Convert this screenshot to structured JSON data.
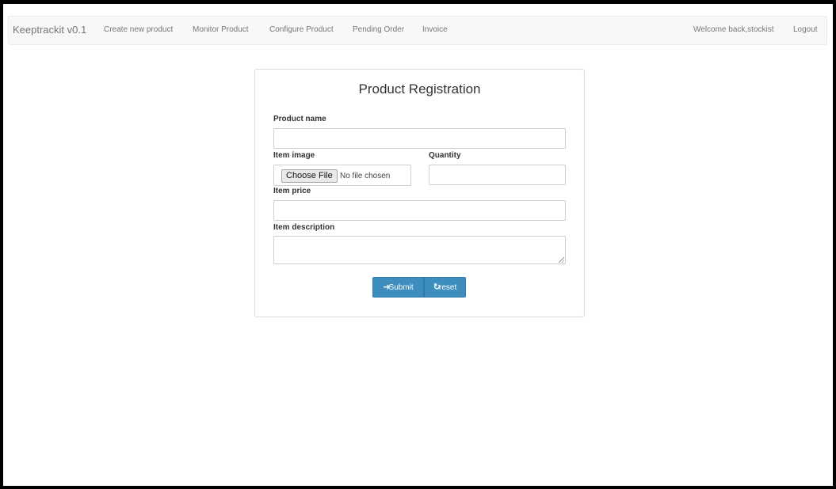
{
  "navbar": {
    "brand": "Keeptrackit v0.1",
    "links": [
      "Create new product",
      "Monitor Product",
      "Configure Product",
      "Pending Order",
      "Invoice"
    ],
    "welcome": "Welcome back,stockist",
    "logout": "Logout"
  },
  "form": {
    "title": "Product Registration",
    "product_name_label": "Product name",
    "item_image_label": "Item image",
    "choose_file_label": "Choose File",
    "no_file_text": "No file chosen",
    "quantity_label": "Quantity",
    "item_price_label": "Item price",
    "item_description_label": "Item description",
    "submit_label": "Submit",
    "reset_label": "reset"
  },
  "colors": {
    "navbar_bg": "#f8f8f8",
    "button_primary": "#3d8ebf"
  }
}
